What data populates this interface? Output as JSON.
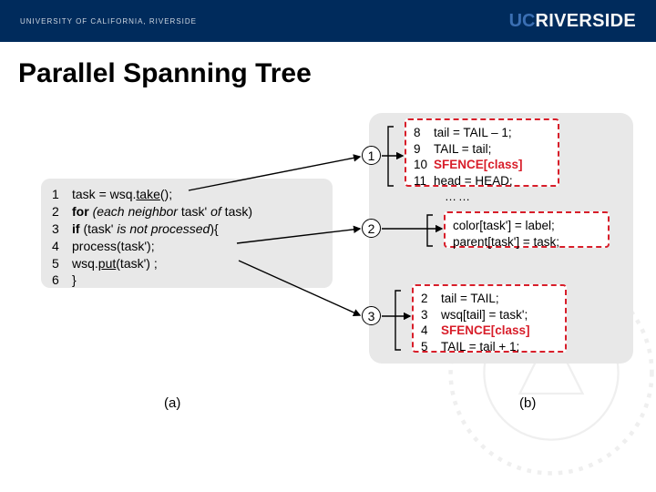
{
  "header": {
    "left": "UNIVERSITY OF CALIFORNIA, RIVERSIDE",
    "right_uc": "UC",
    "right_name": "RIVERSIDE"
  },
  "title": "Parallel Spanning Tree",
  "code_a": [
    {
      "n": "1",
      "t": "task = wsq.",
      "u": "take",
      "after": "();"
    },
    {
      "n": "2",
      "t": " for ",
      "i": "(each neighbor",
      "after": " task' ",
      "i2": "of",
      "after2": " task)"
    },
    {
      "n": "3",
      "t": "    if ",
      "i": "(",
      "after": "task' ",
      "i2": "is not processed",
      "after3": "){"
    },
    {
      "n": "4",
      "t": "        process(task');"
    },
    {
      "n": "5",
      "t": "        wsq.",
      "u": "put",
      "after": "(task') ;"
    },
    {
      "n": "6",
      "t": "    }"
    }
  ],
  "box1": {
    "l1": {
      "n": "8",
      "t": "tail = TAIL – 1;"
    },
    "l2": {
      "n": "9",
      "t": "TAIL = tail;"
    },
    "l3": {
      "n": "10",
      "t": "SFENCE[class]"
    },
    "l4": {
      "n": "11",
      "t": "head = HEAD;"
    }
  },
  "box2": {
    "l1": "color[task'] = label;",
    "l2": "parent[task'] = task;"
  },
  "box3": {
    "l1": {
      "n": "2",
      "t": "tail = TAIL;"
    },
    "l2": {
      "n": "3",
      "t": "wsq[tail] = task';"
    },
    "l3": {
      "n": "4",
      "t": "SFENCE[class]"
    },
    "l4": {
      "n": "5",
      "t": "TAIL = tail + 1;"
    }
  },
  "circles": {
    "c1": "1",
    "c2": "2",
    "c3": "3"
  },
  "labels": {
    "a": "(a)",
    "b": "(b)"
  },
  "dots": "……"
}
